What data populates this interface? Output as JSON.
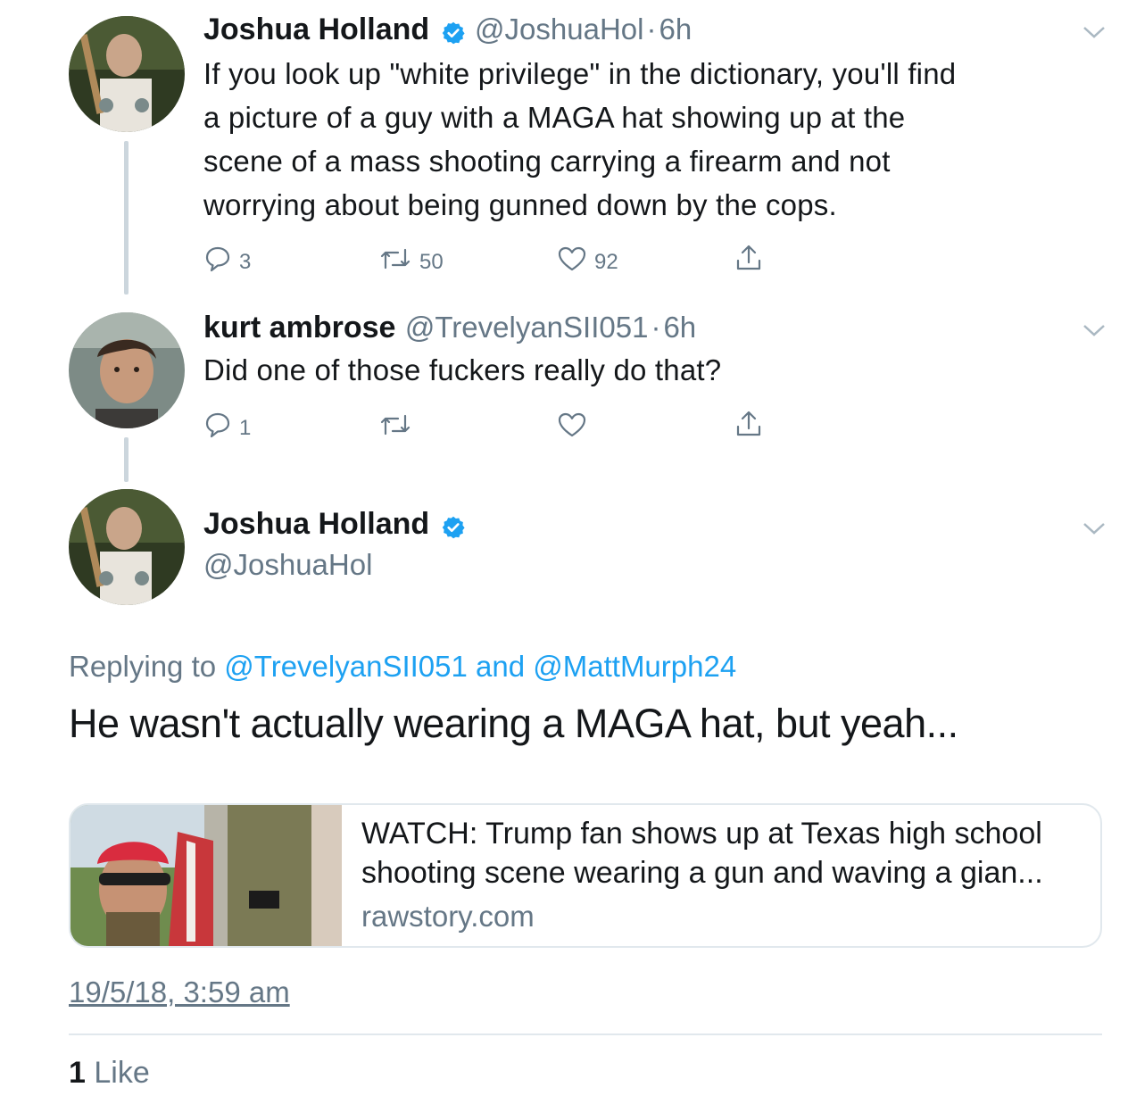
{
  "tweets": [
    {
      "name": "Joshua Holland",
      "handle": "@JoshuaHol",
      "separator": "·",
      "time": "6h",
      "lines": [
        "If you look up \"white privilege\" in the dictionary, you'll find",
        "a picture of a guy with a MAGA hat showing up at the",
        "scene of a mass shooting carrying a firearm and not",
        "worrying about being gunned down by the cops."
      ],
      "replies": "3",
      "retweets": "50",
      "likes": "92"
    },
    {
      "name": "kurt ambrose",
      "handle": "@TrevelyanSII051",
      "separator": "·",
      "time": "6h",
      "lines": [
        "Did one of those fuckers really do that?"
      ],
      "replies": "1",
      "retweets": "",
      "likes": ""
    }
  ],
  "main_tweet": {
    "name": "Joshua Holland",
    "handle": "@JoshuaHol",
    "replying_prefix": "Replying to",
    "replying_user1": "@TrevelyanSII051",
    "replying_and": "and",
    "replying_user2": "@MattMurph24",
    "text": "He wasn't actually wearing a MAGA hat, but yeah...",
    "card": {
      "title_line1": "WATCH: Trump fan shows up at Texas high school",
      "title_line2": "shooting scene wearing a gun and waving a gian...",
      "domain": "rawstory.com"
    },
    "timestamp": "19/5/18, 3:59 am",
    "like_count": "1",
    "like_label": "Like"
  },
  "colors": {
    "link": "#1da1f2",
    "muted": "#657786",
    "verified": "#1da1f2",
    "divider": "#e1e8ed",
    "thread_line": "#ccd6dd"
  },
  "icons": [
    "reply-icon",
    "retweet-icon",
    "like-icon",
    "share-icon",
    "chevron-down-icon",
    "verified-badge-icon"
  ]
}
